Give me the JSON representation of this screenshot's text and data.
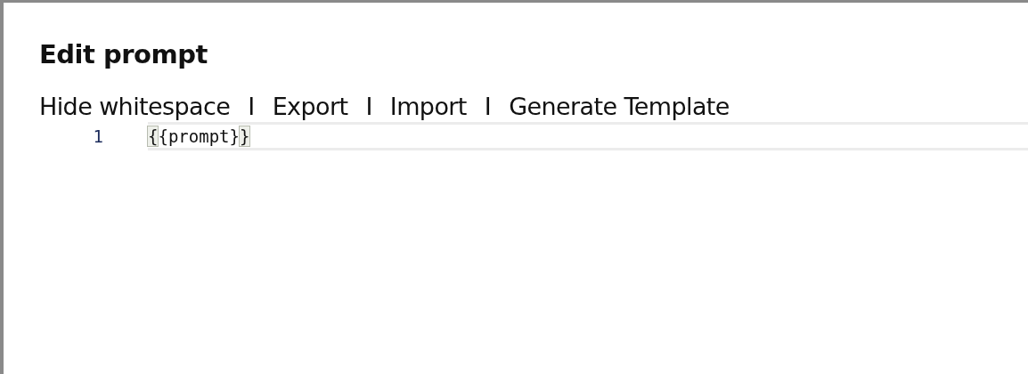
{
  "dialog": {
    "title": "Edit prompt"
  },
  "toolbar": [
    {
      "kind": "link",
      "label": "Hide whitespace"
    },
    {
      "kind": "separator",
      "label": "I"
    },
    {
      "kind": "link",
      "label": "Export"
    },
    {
      "kind": "separator",
      "label": "I"
    },
    {
      "kind": "link",
      "label": "Import"
    },
    {
      "kind": "separator",
      "label": "I"
    },
    {
      "kind": "link",
      "label": "Generate Template"
    }
  ],
  "editor": {
    "lines": [
      {
        "number": "1",
        "code": "{{prompt}}",
        "bracket_match": true
      }
    ]
  }
}
